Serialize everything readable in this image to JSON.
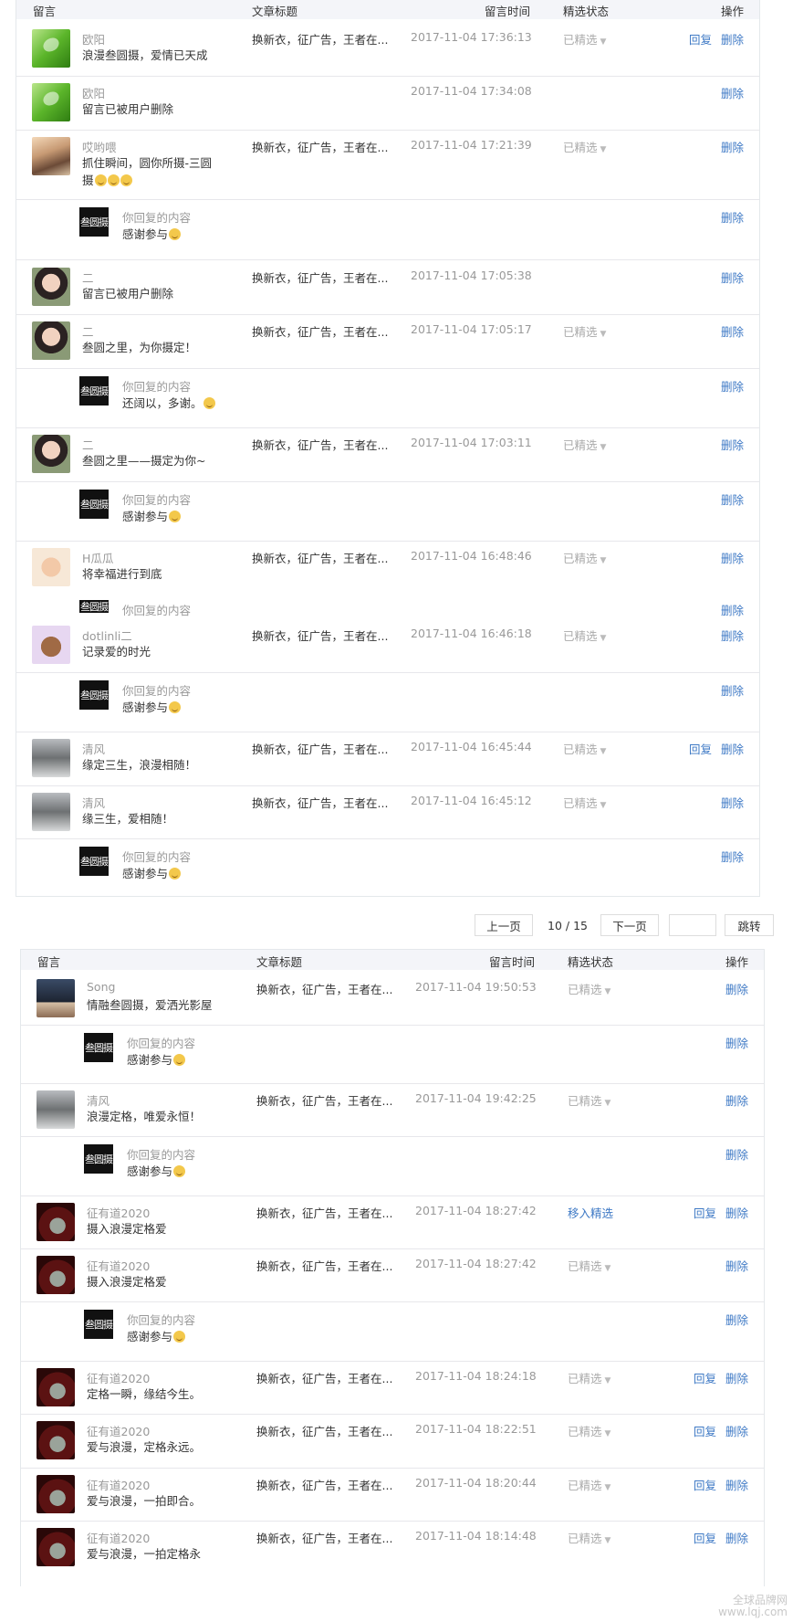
{
  "header": {
    "comment": "留言",
    "article": "文章标题",
    "time": "留言时间",
    "status": "精选状态",
    "ops": "操作"
  },
  "common": {
    "article_title": "换新衣，征广告，王者在...",
    "reply": "回复",
    "delete": "删除",
    "featured": "已精选",
    "move_featured": "移入精选",
    "your_reply": "你回复的内容",
    "logo_text": "叁圆摄"
  },
  "panel1": {
    "rows": [
      {
        "name": "欧阳",
        "msg": "浪漫叁圆摄，爱情已天成",
        "time": "2017-11-04 17:36:13"
      },
      {
        "name": "欧阳",
        "msg": "留言已被用户删除",
        "time": "2017-11-04 17:34:08"
      },
      {
        "name": "哎哟喂",
        "msg1": "抓住瞬间，圆你所摄-三圆",
        "msg2": "摄",
        "time": "2017-11-04 17:21:39",
        "reply": "感谢参与"
      },
      {
        "name": "二",
        "msg": "留言已被用户删除",
        "time": "2017-11-04 17:05:38"
      },
      {
        "name": "二",
        "msg": "叁圆之里，为你摄定！",
        "time": "2017-11-04 17:05:17",
        "reply": "还阔以，多谢。"
      },
      {
        "name": "二",
        "msg": "叁圆之里——摄定为你~",
        "time": "2017-11-04 17:03:11",
        "reply": "感谢参与"
      },
      {
        "name": "H瓜瓜",
        "msg": "将幸福进行到底",
        "time": "2017-11-04 16:48:46"
      },
      {
        "name": "dotlinli二",
        "msg": "记录爱的时光",
        "time": "2017-11-04 16:46:18",
        "reply": "感谢参与"
      },
      {
        "name": "清风",
        "msg": "缘定三生，浪漫相随！",
        "time": "2017-11-04 16:45:44"
      },
      {
        "name": "清风",
        "msg": "缘三生，爱相随！",
        "time": "2017-11-04 16:45:12",
        "reply": "感谢参与"
      }
    ]
  },
  "pager": {
    "prev": "上一页",
    "info": "10 / 15",
    "next": "下一页",
    "jump_value": "",
    "jump": "跳转"
  },
  "panel2": {
    "rows": [
      {
        "name": "Song",
        "msg": "情融叁圆摄，爱洒光影屋",
        "time": "2017-11-04 19:50:53",
        "reply": "感谢参与"
      },
      {
        "name": "清风",
        "msg": "浪漫定格，唯爱永恒！",
        "time": "2017-11-04 19:42:25",
        "reply": "感谢参与"
      },
      {
        "name": "征有道2020",
        "msg": "摄入浪漫定格爱",
        "time": "2017-11-04 18:27:42"
      },
      {
        "name": "征有道2020",
        "msg": "摄入浪漫定格爱",
        "time": "2017-11-04 18:27:42",
        "reply": "感谢参与"
      },
      {
        "name": "征有道2020",
        "msg": "定格一瞬，缘结今生。",
        "time": "2017-11-04 18:24:18"
      },
      {
        "name": "征有道2020",
        "msg": "爱与浪漫，定格永远。",
        "time": "2017-11-04 18:22:51"
      },
      {
        "name": "征有道2020",
        "msg": "爱与浪漫，一拍即合。",
        "time": "2017-11-04 18:20:44"
      },
      {
        "name": "征有道2020",
        "msg": "爱与浪漫，一拍定格永",
        "time": "2017-11-04 18:14:48"
      }
    ]
  },
  "watermark": {
    "line1": "全球品牌网",
    "line2": "www.lqj.com"
  }
}
